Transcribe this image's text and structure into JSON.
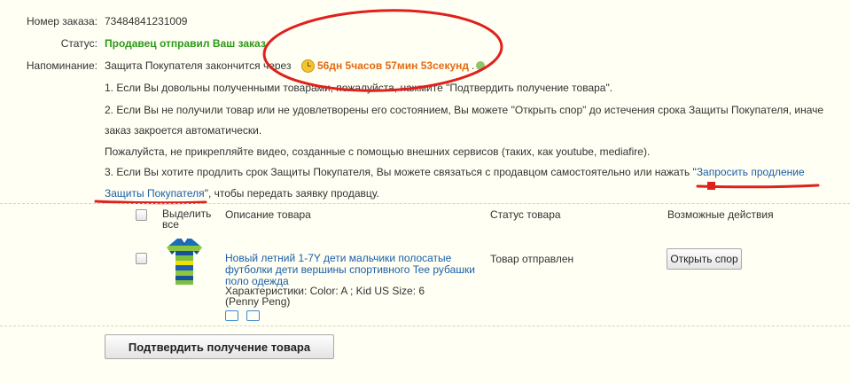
{
  "order": {
    "number_label": "Номер заказа:",
    "number": "73484841231009",
    "status_label": "Статус:",
    "status": "Продавец отправил Ваш заказ",
    "reminder_label": "Напоминание:",
    "reminder_text": "Защита Покупателя закончится через",
    "countdown": "56дн 5часов 57мин 53секунд",
    "countdown_suffix": "."
  },
  "notes": {
    "line1": "1. Если Вы довольны полученными товарами, пожалуйста, нажмите \"Подтвердить получение товара\".",
    "line2a": "2. Если Вы не получили товар или не удовлетворены его состоянием, Вы можете \"Открыть спор\" до истечения срока Защиты Покупателя, иначе",
    "line2b": "заказ закроется автоматически.",
    "line3": "Пожалуйста, не прикрепляйте видео, созданные с помощью внешних сервисов (таких, как youtube, mediafire).",
    "line4a": "3. Если Вы хотите продлить срок Защиты Покупателя, Вы можете связаться с продавцом самостоятельно или нажать \"",
    "line4_link_a": "Запросить продление",
    "line4_link_b": "Защиты Покупателя",
    "line4b_suffix": "\", чтобы передать заявку продавцу."
  },
  "table": {
    "select_all_line1": "Выделить",
    "select_all_line2": "все",
    "col_desc": "Описание товара",
    "col_status": "Статус товара",
    "col_actions": "Возможные действия"
  },
  "item": {
    "title_line1": "Новый летний 1-7Y дети мальчики полосатые",
    "title_line2": "футболки дети вершины спортивного Tee рубашки",
    "title_line3": "поло одежда",
    "props": "Характеристики: Color: A   ; Kid US Size: 6",
    "seller": "(Penny Peng)",
    "status": "Товар отправлен",
    "dispute_button": "Открыть спор"
  },
  "confirm_button": "Подтвердить получение товара",
  "colors": {
    "background": "#fffff3",
    "status_green": "#2a9a16",
    "countdown_orange": "#e36a13",
    "link_blue": "#1a5fa8",
    "annotation_red": "#e0201d"
  }
}
